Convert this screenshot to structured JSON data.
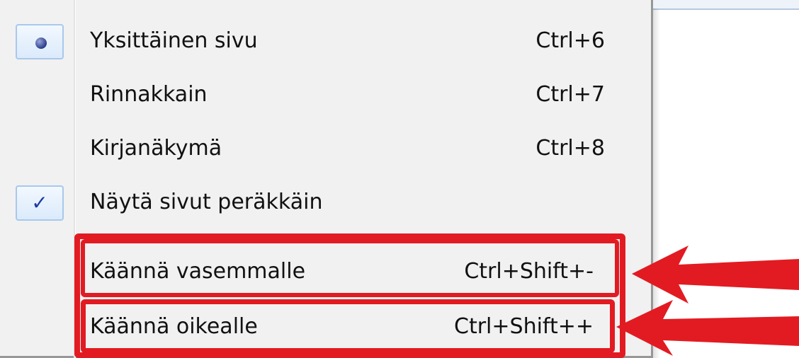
{
  "menu": {
    "items": [
      {
        "label": "Yksittäinen sivu",
        "shortcut": "Ctrl+6",
        "state": "radio-selected"
      },
      {
        "label": "Rinnakkain",
        "shortcut": "Ctrl+7",
        "state": "none"
      },
      {
        "label": "Kirjanäkymä",
        "shortcut": "Ctrl+8",
        "state": "none"
      },
      {
        "label": "Näytä sivut peräkkäin",
        "shortcut": "",
        "state": "checked"
      },
      {
        "label": "Käännä vasemmalle",
        "shortcut": "Ctrl+Shift+-",
        "state": "highlighted"
      },
      {
        "label": "Käännä oikealle",
        "shortcut": "Ctrl+Shift++",
        "state": "highlighted"
      }
    ]
  },
  "icons": {
    "radio": "radio-dot-icon",
    "check": "checkmark-icon",
    "arrow": "red-arrow-icon"
  },
  "colors": {
    "highlight": "#e21b22",
    "menu_bg": "#f1f1f1",
    "check_box_border": "#a8c8ec",
    "check_mark": "#1c3aa4"
  }
}
